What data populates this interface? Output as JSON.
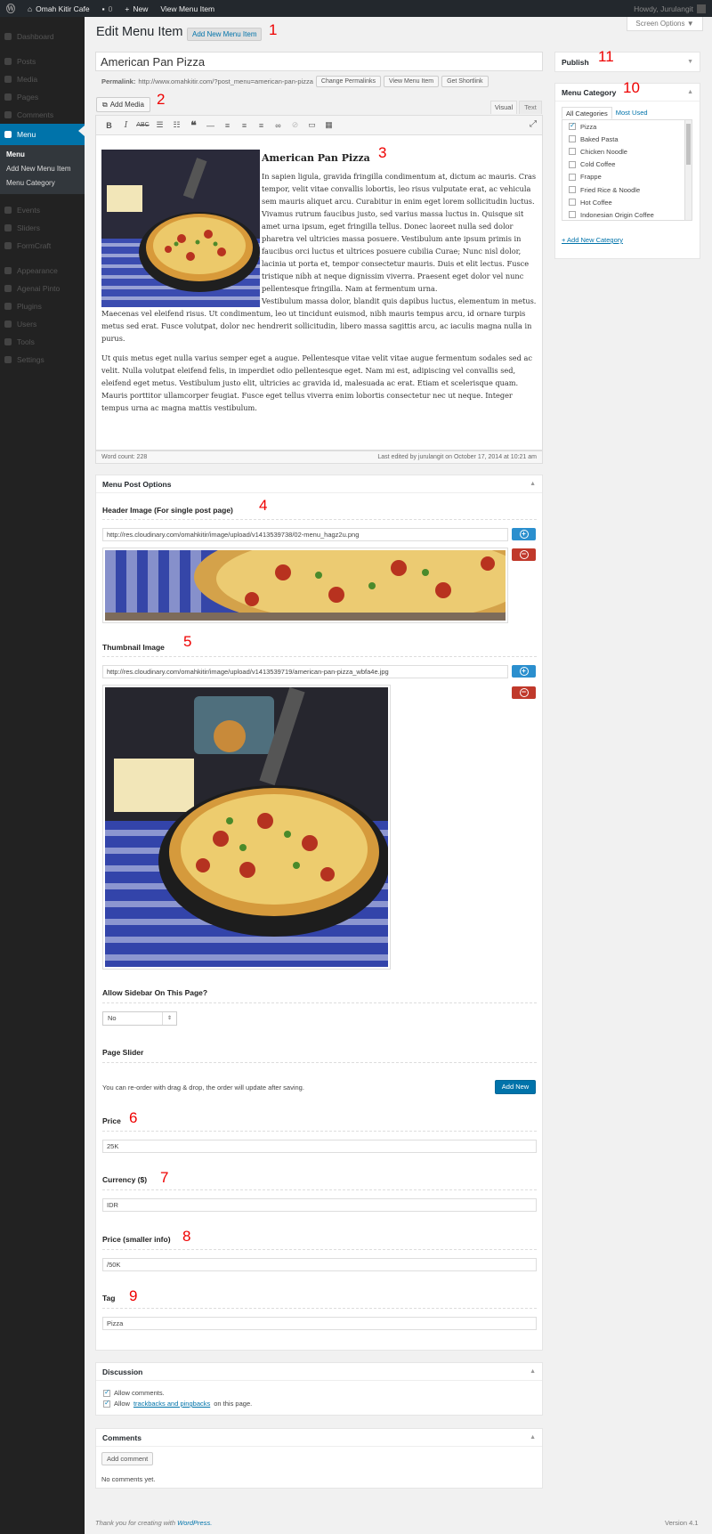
{
  "adminbar": {
    "site_name": "Omah Kitir Cafe",
    "comments_count": "0",
    "new_label": "New",
    "view_label": "View Menu Item",
    "howdy": "Howdy, Jurulangit"
  },
  "sidebar": {
    "items_top": [
      "Dashboard",
      "Posts",
      "Media",
      "Pages",
      "Comments"
    ],
    "active": "Menu",
    "submenu": [
      "Menu",
      "Add New Menu Item",
      "Menu Category"
    ],
    "items_bottom": [
      "Events",
      "Sliders",
      "FormCraft"
    ],
    "items_bottom2": [
      "Appearance",
      "Agenai Pinto",
      "Plugins",
      "Users",
      "Tools",
      "Settings"
    ]
  },
  "screen_options": "Screen Options ▼",
  "page": {
    "title": "Edit Menu Item",
    "add_new": "Add New Menu Item"
  },
  "annotations": [
    "1",
    "2",
    "3",
    "4",
    "5",
    "6",
    "7",
    "8",
    "9",
    "10",
    "11"
  ],
  "post": {
    "title": "American Pan Pizza",
    "permalink_label": "Permalink:",
    "permalink_url": "http://www.omahkitir.com/?post_menu=american-pan-pizza",
    "change_permalinks": "Change Permalinks",
    "view_menu_item": "View Menu Item",
    "get_shortlink": "Get Shortlink"
  },
  "editor": {
    "add_media": "Add Media",
    "tab_visual": "Visual",
    "tab_text": "Text",
    "heading": "American Pan Pizza",
    "para1": "In sapien ligula, gravida fringilla condimentum at, dictum ac mauris. Cras tempor, velit vitae convallis lobortis, leo risus vulputate erat, ac vehicula sem mauris aliquet arcu. Curabitur in enim eget lorem sollicitudin luctus. Vivamus rutrum faucibus justo, sed varius massa luctus in. Quisque sit amet urna ipsum, eget fringilla tellus. Donec laoreet nulla sed dolor pharetra vel ultricies massa posuere. Vestibulum ante ipsum primis in faucibus orci luctus et ultrices posuere cubilia Curae; Nunc nisl dolor, lacinia ut porta et, tempor consectetur mauris. Duis et elit lectus. Fusce tristique nibh at neque dignissim viverra. Praesent eget dolor vel nunc pellentesque fringilla. Nam at fermentum urna.",
    "para2": "Vestibulum massa dolor, blandit quis dapibus luctus, elementum in metus. Maecenas vel eleifend risus. Ut condimentum, leo ut tincidunt euismod, nibh mauris tempus arcu, id ornare turpis metus sed erat. Fusce volutpat, dolor nec hendrerit sollicitudin, libero massa sagittis arcu, ac iaculis magna nulla in purus.",
    "para3": "Ut quis metus eget nulla varius semper eget a augue. Pellentesque vitae velit vitae augue fermentum sodales sed ac velit. Nulla volutpat eleifend felis, in imperdiet odio pellentesque eget. Nam mi est, adipiscing vel convallis sed, eleifend eget metus. Vestibulum justo elit, ultricies ac gravida id, malesuada ac erat. Etiam et scelerisque quam. Mauris porttitor ullamcorper feugiat. Fusce eget tellus viverra enim lobortis consectetur nec ut neque. Integer tempus urna ac magna mattis vestibulum.",
    "word_count": "Word count: 228",
    "last_edited": "Last edited by jurulangit on October 17, 2014 at 10:21 am"
  },
  "menu_options": {
    "box_title": "Menu Post Options",
    "header_image_label": "Header Image (For single post page)",
    "header_image_url": "http://res.cloudinary.com/omahkitir/image/upload/v1413539738/02-menu_hagz2u.png",
    "thumbnail_label": "Thumbnail Image",
    "thumbnail_url": "http://res.cloudinary.com/omahkitir/image/upload/v1413539719/american-pan-pizza_wbfa4e.jpg",
    "sidebar_label": "Allow Sidebar On This Page?",
    "sidebar_value": "No",
    "slider_label": "Page Slider",
    "slider_note": "You can re-order with drag & drop, the order will update after saving.",
    "add_new": "Add New",
    "price_label": "Price",
    "price_value": "25K",
    "currency_label": "Currency ($)",
    "currency_value": "IDR",
    "price_small_label": "Price (smaller info)",
    "price_small_value": "/50K",
    "tag_label": "Tag",
    "tag_value": "Pizza"
  },
  "discussion": {
    "title": "Discussion",
    "allow_comments": "Allow comments.",
    "allow_prefix": "Allow",
    "trackbacks_link": "trackbacks and pingbacks",
    "allow_suffix": "on this page."
  },
  "comments": {
    "title": "Comments",
    "add_comment": "Add comment",
    "none": "No comments yet."
  },
  "publish": {
    "title": "Publish"
  },
  "category": {
    "title": "Menu Category",
    "tab_all": "All Categories",
    "tab_used": "Most Used",
    "items": [
      "Pizza",
      "Baked Pasta",
      "Chicken Noodle",
      "Cold Coffee",
      "Frappe",
      "Fried Rice & Noodle",
      "Hot Coffee",
      "Indonesian Origin Coffee"
    ],
    "checked": [
      true,
      false,
      false,
      false,
      false,
      false,
      false,
      false
    ],
    "add_link": "+ Add New Category"
  },
  "footer": {
    "thanks": "Thank you for creating with",
    "wp": "WordPress.",
    "version": "Version 4.1"
  },
  "colors": {
    "accent": "#0073aa",
    "danger": "#c0392b",
    "admin_bg": "#23282d",
    "annotation": "#ee0000"
  }
}
